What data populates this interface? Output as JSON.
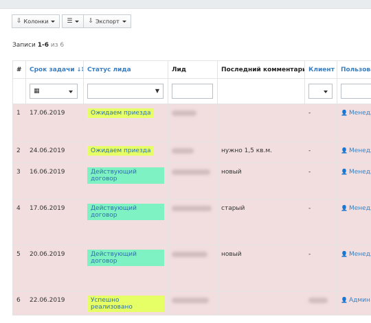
{
  "toolbar": {
    "columns_label": "Колонки",
    "export_label": "Экспорт"
  },
  "records": {
    "prefix": "Записи",
    "range": "1-6",
    "of_label": "из 6"
  },
  "table": {
    "headers": {
      "num": "#",
      "due_date": "Срок задачи",
      "status": "Статус лида",
      "lead": "Лид",
      "last_comment": "Последний комментарий",
      "client": "Клиент",
      "user": "Пользовател"
    },
    "rows": [
      {
        "num": "1",
        "date": "17.06.2019",
        "status": "Ожидаем приезда",
        "status_color": "#e6ff66",
        "comment": "",
        "client": "-",
        "user": "Менедж"
      },
      {
        "num": "2",
        "date": "24.06.2019",
        "status": "Ожидаем приезда",
        "status_color": "#e6ff66",
        "comment": "нужно 1,5 кв.м.",
        "client": "-",
        "user": "Менедж"
      },
      {
        "num": "3",
        "date": "16.06.2019",
        "status": "Действующий договор",
        "status_color": "#7ff2c4",
        "comment": "новый",
        "client": "-",
        "user": "Менедж"
      },
      {
        "num": "4",
        "date": "17.06.2019",
        "status": "Действующий договор",
        "status_color": "#7ff2c4",
        "comment": "старый",
        "client": "-",
        "user": "Менедж"
      },
      {
        "num": "5",
        "date": "20.06.2019",
        "status": "Действующий договор",
        "status_color": "#7ff2c4",
        "comment": "новый",
        "client": "-",
        "user": "Менедж"
      },
      {
        "num": "6",
        "date": "22.06.2019",
        "status": "Успешно реализовано",
        "status_color": "#e6ff66",
        "comment": "",
        "client": "",
        "user": "Админ"
      }
    ]
  },
  "icons": {
    "columns": "columns-icon",
    "list": "list-icon",
    "export": "export-icon",
    "sort": "sort-ascending-icon",
    "calendar": "calendar-icon",
    "user": "user-icon"
  },
  "colors": {
    "row_bg": "#f2dede",
    "link": "#3a7fc1",
    "status_yellow": "#e6ff66",
    "status_green": "#7ff2c4"
  }
}
